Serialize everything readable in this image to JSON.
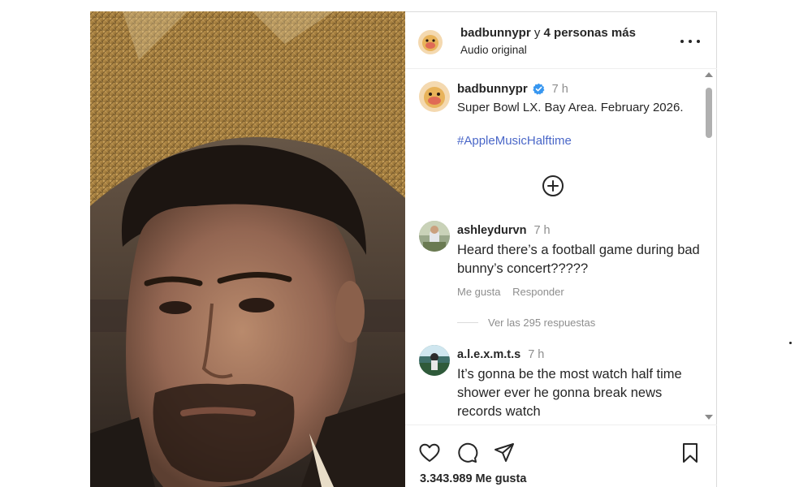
{
  "post_header": {
    "username": "badbunnypr",
    "conjunction": "y",
    "more_people": "4 personas más",
    "audio": "Audio original"
  },
  "caption": {
    "username": "badbunnypr",
    "time": "7 h",
    "text": "Super Bowl LX. Bay Area. February 2026.",
    "hashtag": "#AppleMusicHalftime"
  },
  "comments": [
    {
      "username": "ashleydurvn",
      "time": "7 h",
      "text": "Heard there’s a football game during bad bunny’s concert?????",
      "like_label": "Me gusta",
      "reply_label": "Responder",
      "view_replies": "Ver las 295 respuestas"
    },
    {
      "username": "a.l.e.x.m.t.s",
      "time": "7 h",
      "text": "It’s gonna be the most watch half time shower ever he gonna break news records watch"
    }
  ],
  "footer": {
    "likes": "3.343.989 Me gusta"
  },
  "icons": {
    "more": "more-horizontal-icon",
    "verified": "verified-badge-icon",
    "add": "plus-circle-icon",
    "like": "heart-icon",
    "comment": "comment-bubble-icon",
    "share": "send-plane-icon",
    "save": "bookmark-icon"
  },
  "colors": {
    "hashtag": "#4a67c8",
    "verified": "#3897f0",
    "muted_text": "#8e8e8e"
  }
}
